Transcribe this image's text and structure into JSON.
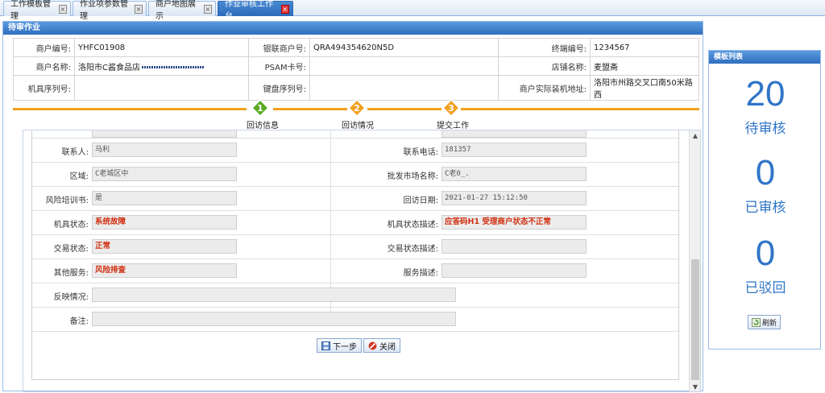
{
  "tabs": [
    {
      "label": "工作模板管理",
      "active": false
    },
    {
      "label": "作业项参数管理",
      "active": false
    },
    {
      "label": "商户地图展示",
      "active": false
    },
    {
      "label": "作业审核工作台",
      "active": true
    }
  ],
  "panel": {
    "title": "待审作业"
  },
  "merchant": {
    "rows": [
      [
        {
          "label": "商户编号:",
          "value": "YHFC01908"
        },
        {
          "label": "银联商户号:",
          "value": "QRA494354620N5D"
        },
        {
          "label": "终端编号:",
          "value": "1234567"
        }
      ],
      [
        {
          "label": "商户名称:",
          "value": "洛阳市C酱食品店"
        },
        {
          "label": "PSAM卡号:",
          "value": ""
        },
        {
          "label": "店铺名称:",
          "value": "麦盟斋"
        }
      ],
      [
        {
          "label": "机具序列号:",
          "value": ""
        },
        {
          "label": "键盘序列号:",
          "value": ""
        },
        {
          "label": "商户实际装机地址:",
          "value": "洛阳市州路交叉口南50米路西"
        }
      ]
    ]
  },
  "steps": [
    {
      "num": "1",
      "label": "回访信息",
      "color": "#5aaa28"
    },
    {
      "num": "2",
      "label": "回访情况",
      "color": "#f0a020"
    },
    {
      "num": "3",
      "label": "提交工作",
      "color": "#f0a020"
    }
  ],
  "form": {
    "rows": [
      {
        "left": {
          "label": "联系人:",
          "value": "马利",
          "red": false
        },
        "right": {
          "label": "联系电话:",
          "value": "181357",
          "red": false
        }
      },
      {
        "left": {
          "label": "区域:",
          "value": "C老城区中",
          "red": false
        },
        "right": {
          "label": "批发市场名称:",
          "value": "C老0_.",
          "red": false
        }
      },
      {
        "left": {
          "label": "风险培训书:",
          "value": "是",
          "red": false
        },
        "right": {
          "label": "回访日期:",
          "value": "2021-01-27 15:12:50",
          "red": false
        }
      },
      {
        "left": {
          "label": "机具状态:",
          "value": "系统故障",
          "red": true
        },
        "right": {
          "label": "机具状态描述:",
          "value": "应答码H1 受理商户状态不正常",
          "red": true
        }
      },
      {
        "left": {
          "label": "交易状态:",
          "value": "正常",
          "red": true
        },
        "right": {
          "label": "交易状态描述:",
          "value": "",
          "red": false
        }
      },
      {
        "left": {
          "label": "其他服务:",
          "value": "风险排查",
          "red": true
        },
        "right": {
          "label": "服务描述:",
          "value": "",
          "red": false
        }
      }
    ],
    "feedback_label": "反映情况:",
    "feedback_value": "",
    "remark_label": "备注:",
    "remark_value": "",
    "next_button": "下一步",
    "close_button": "关闭"
  },
  "side": {
    "title": "模板列表",
    "stats": [
      {
        "num": "20",
        "label": "待审核"
      },
      {
        "num": "0",
        "label": "已审核"
      },
      {
        "num": "0",
        "label": "已驳回"
      }
    ],
    "refresh_button": "刷新"
  },
  "colors": {
    "accent": "#2f75c8",
    "warn": "#d03010",
    "step": "#f0a020"
  }
}
